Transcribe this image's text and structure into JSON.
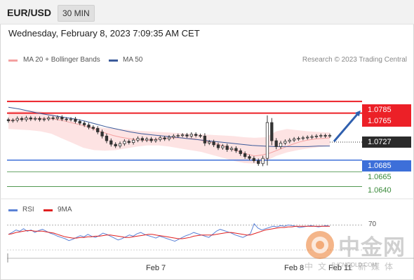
{
  "header": {
    "symbol": "EUR/USD",
    "timeframe": "30 MIN"
  },
  "timestamp": "Wednesday, February 8, 2023 7:09:35 AM CET",
  "legend": {
    "ma20": "MA 20 + Bollinger Bands",
    "ma50": "MA 50"
  },
  "credit": "Research © 2023 Trading Central",
  "price_levels": {
    "target_1": "1.0785",
    "target_2": "1.0765",
    "last_price": "1.0727",
    "pivot": "1.0685",
    "support_1": "1.0665",
    "support_2": "1.0640"
  },
  "rsi_legend": {
    "rsi": "RSI",
    "ma9": "9MA"
  },
  "rsi_level_label": "70",
  "x_axis": {
    "tick_1": "Feb 7",
    "tick_2": "Feb 8",
    "tick_3": "Feb 11"
  },
  "watermark": {
    "brand": "中金网",
    "domain": "CNGOLD.COM",
    "tagline": "中文财经新媒体"
  },
  "colors": {
    "resistance": "#ec2027",
    "pivot": "#3d6fd9",
    "support": "#3a8a3a",
    "bollinger_fill": "#fde3e3",
    "ma20": "#f4a0a0",
    "ma50": "#3b5a9a",
    "rsi": "#5b82d6",
    "ma9": "#e02020",
    "arrow": "#2f5fae"
  },
  "chart_data": {
    "type": "candlestick",
    "price_axis": {
      "ylim": [
        1.0625,
        1.0835
      ]
    },
    "horizontal_levels": [
      1.0785,
      1.0765,
      1.0685,
      1.0665,
      1.064
    ],
    "closes": [
      1.0752,
      1.0753,
      1.0756,
      1.0754,
      1.0757,
      1.0755,
      1.0756,
      1.0754,
      1.0755,
      1.0757,
      1.0756,
      1.0758,
      1.0755,
      1.0754,
      1.0755,
      1.0751,
      1.0748,
      1.0745,
      1.0741,
      1.0739,
      1.0733,
      1.0726,
      1.0718,
      1.0712,
      1.0709,
      1.0713,
      1.0717,
      1.0715,
      1.0719,
      1.0722,
      1.0719,
      1.0721,
      1.0718,
      1.072,
      1.0723,
      1.0721,
      1.0724,
      1.0726,
      1.0727,
      1.0728,
      1.0726,
      1.0729,
      1.0727,
      1.0726,
      1.0714,
      1.0716,
      1.0711,
      1.0706,
      1.0709,
      1.0703,
      1.0705,
      1.0701,
      1.0696,
      1.0691,
      1.0688,
      1.0684,
      1.0679,
      1.0688,
      1.0749,
      1.0718,
      1.0708,
      1.0714,
      1.0717,
      1.0719,
      1.0721,
      1.0722,
      1.0723,
      1.0724,
      1.0725,
      1.0726,
      1.0727,
      1.0726,
      1.0727
    ],
    "ma20": [
      1.0752,
      1.0754,
      1.0755,
      1.0755,
      1.0756,
      1.0756,
      1.0755,
      1.0753,
      1.075,
      1.0747,
      1.0744,
      1.074,
      1.0735,
      1.0731,
      1.0727,
      1.0724,
      1.0722,
      1.072,
      1.0719,
      1.0719,
      1.0721,
      1.0722,
      1.0723,
      1.0723,
      1.0722,
      1.0721,
      1.0718,
      1.0716,
      1.0712,
      1.0708,
      1.0703,
      1.0699,
      1.0695,
      1.0692,
      1.0694,
      1.0697,
      1.0702,
      1.0707,
      1.0712,
      1.0716,
      1.0719,
      1.0721,
      1.0722,
      1.0723
    ],
    "ma50": [
      1.0775,
      1.0772,
      1.0768,
      1.0764,
      1.0761,
      1.0758,
      1.0755,
      1.0751,
      1.0746,
      1.0741,
      1.0737,
      1.0733,
      1.073,
      1.0728,
      1.0726,
      1.0724,
      1.0722,
      1.072,
      1.0718,
      1.0716,
      1.0714,
      1.0712,
      1.071,
      1.0709,
      1.0708,
      1.0708,
      1.0708,
      1.0708,
      1.0709,
      1.0709
    ],
    "bb_upper": [
      1.0768,
      1.0769,
      1.077,
      1.0768,
      1.0764,
      1.0758,
      1.0752,
      1.0746,
      1.0742,
      1.074,
      1.0738,
      1.0737,
      1.0735,
      1.0734,
      1.0733,
      1.0732,
      1.0731,
      1.073,
      1.0729,
      1.0728,
      1.0727,
      1.0726,
      1.0724,
      1.0723,
      1.0724,
      1.0734,
      1.0738,
      1.0736,
      1.0734,
      1.0733,
      1.0732
    ],
    "bb_lower": [
      1.0738,
      1.0737,
      1.0736,
      1.0734,
      1.073,
      1.0722,
      1.0714,
      1.0706,
      1.0702,
      1.0701,
      1.0702,
      1.0705,
      1.0708,
      1.071,
      1.071,
      1.0708,
      1.0705,
      1.0702,
      1.0699,
      1.0694,
      1.0689,
      1.0684,
      1.068,
      1.0679,
      1.0683,
      1.0692,
      1.0698,
      1.0702,
      1.0705,
      1.0707,
      1.0709
    ],
    "rsi": [
      55,
      58,
      62,
      60,
      64,
      60,
      62,
      58,
      61,
      63,
      60,
      57,
      55,
      52,
      50,
      48,
      45,
      47,
      50,
      53,
      51,
      55,
      52,
      50,
      53,
      57,
      55,
      52,
      49,
      46,
      48,
      51,
      54,
      52,
      56,
      58,
      55,
      53,
      51,
      49,
      52,
      50,
      48,
      46,
      44,
      47,
      50,
      53,
      55,
      58,
      56,
      54,
      52,
      50,
      55,
      60,
      63,
      61,
      59,
      57,
      54,
      52,
      50,
      53,
      56,
      72,
      65,
      62,
      64,
      66,
      68,
      67,
      69,
      68,
      70,
      69,
      68,
      66,
      67,
      68,
      69,
      68,
      67,
      68,
      69,
      68
    ],
    "ma9": [
      55,
      56,
      58,
      59,
      60,
      61,
      61,
      60,
      60,
      60,
      59,
      58,
      57,
      55,
      53,
      51,
      50,
      49,
      49,
      50,
      50,
      51,
      51,
      52,
      52,
      53,
      54,
      54,
      53,
      52,
      51,
      50,
      50,
      51,
      52,
      53,
      54,
      55,
      55,
      54,
      53,
      52,
      51,
      50,
      49,
      48,
      48,
      49,
      50,
      52,
      53,
      54,
      54,
      54,
      54,
      55,
      56,
      57,
      58,
      58,
      57,
      56,
      55,
      54,
      54,
      56,
      58,
      60,
      62,
      63,
      64,
      65,
      66,
      66,
      67,
      67,
      68,
      68,
      68,
      68,
      68,
      68,
      68,
      68,
      68,
      68
    ],
    "rsi_ylim": [
      20,
      85
    ],
    "rsi_levels": [
      70
    ],
    "x_tick_labels": [
      "Feb 7",
      "Feb 8",
      "Feb 11"
    ]
  }
}
